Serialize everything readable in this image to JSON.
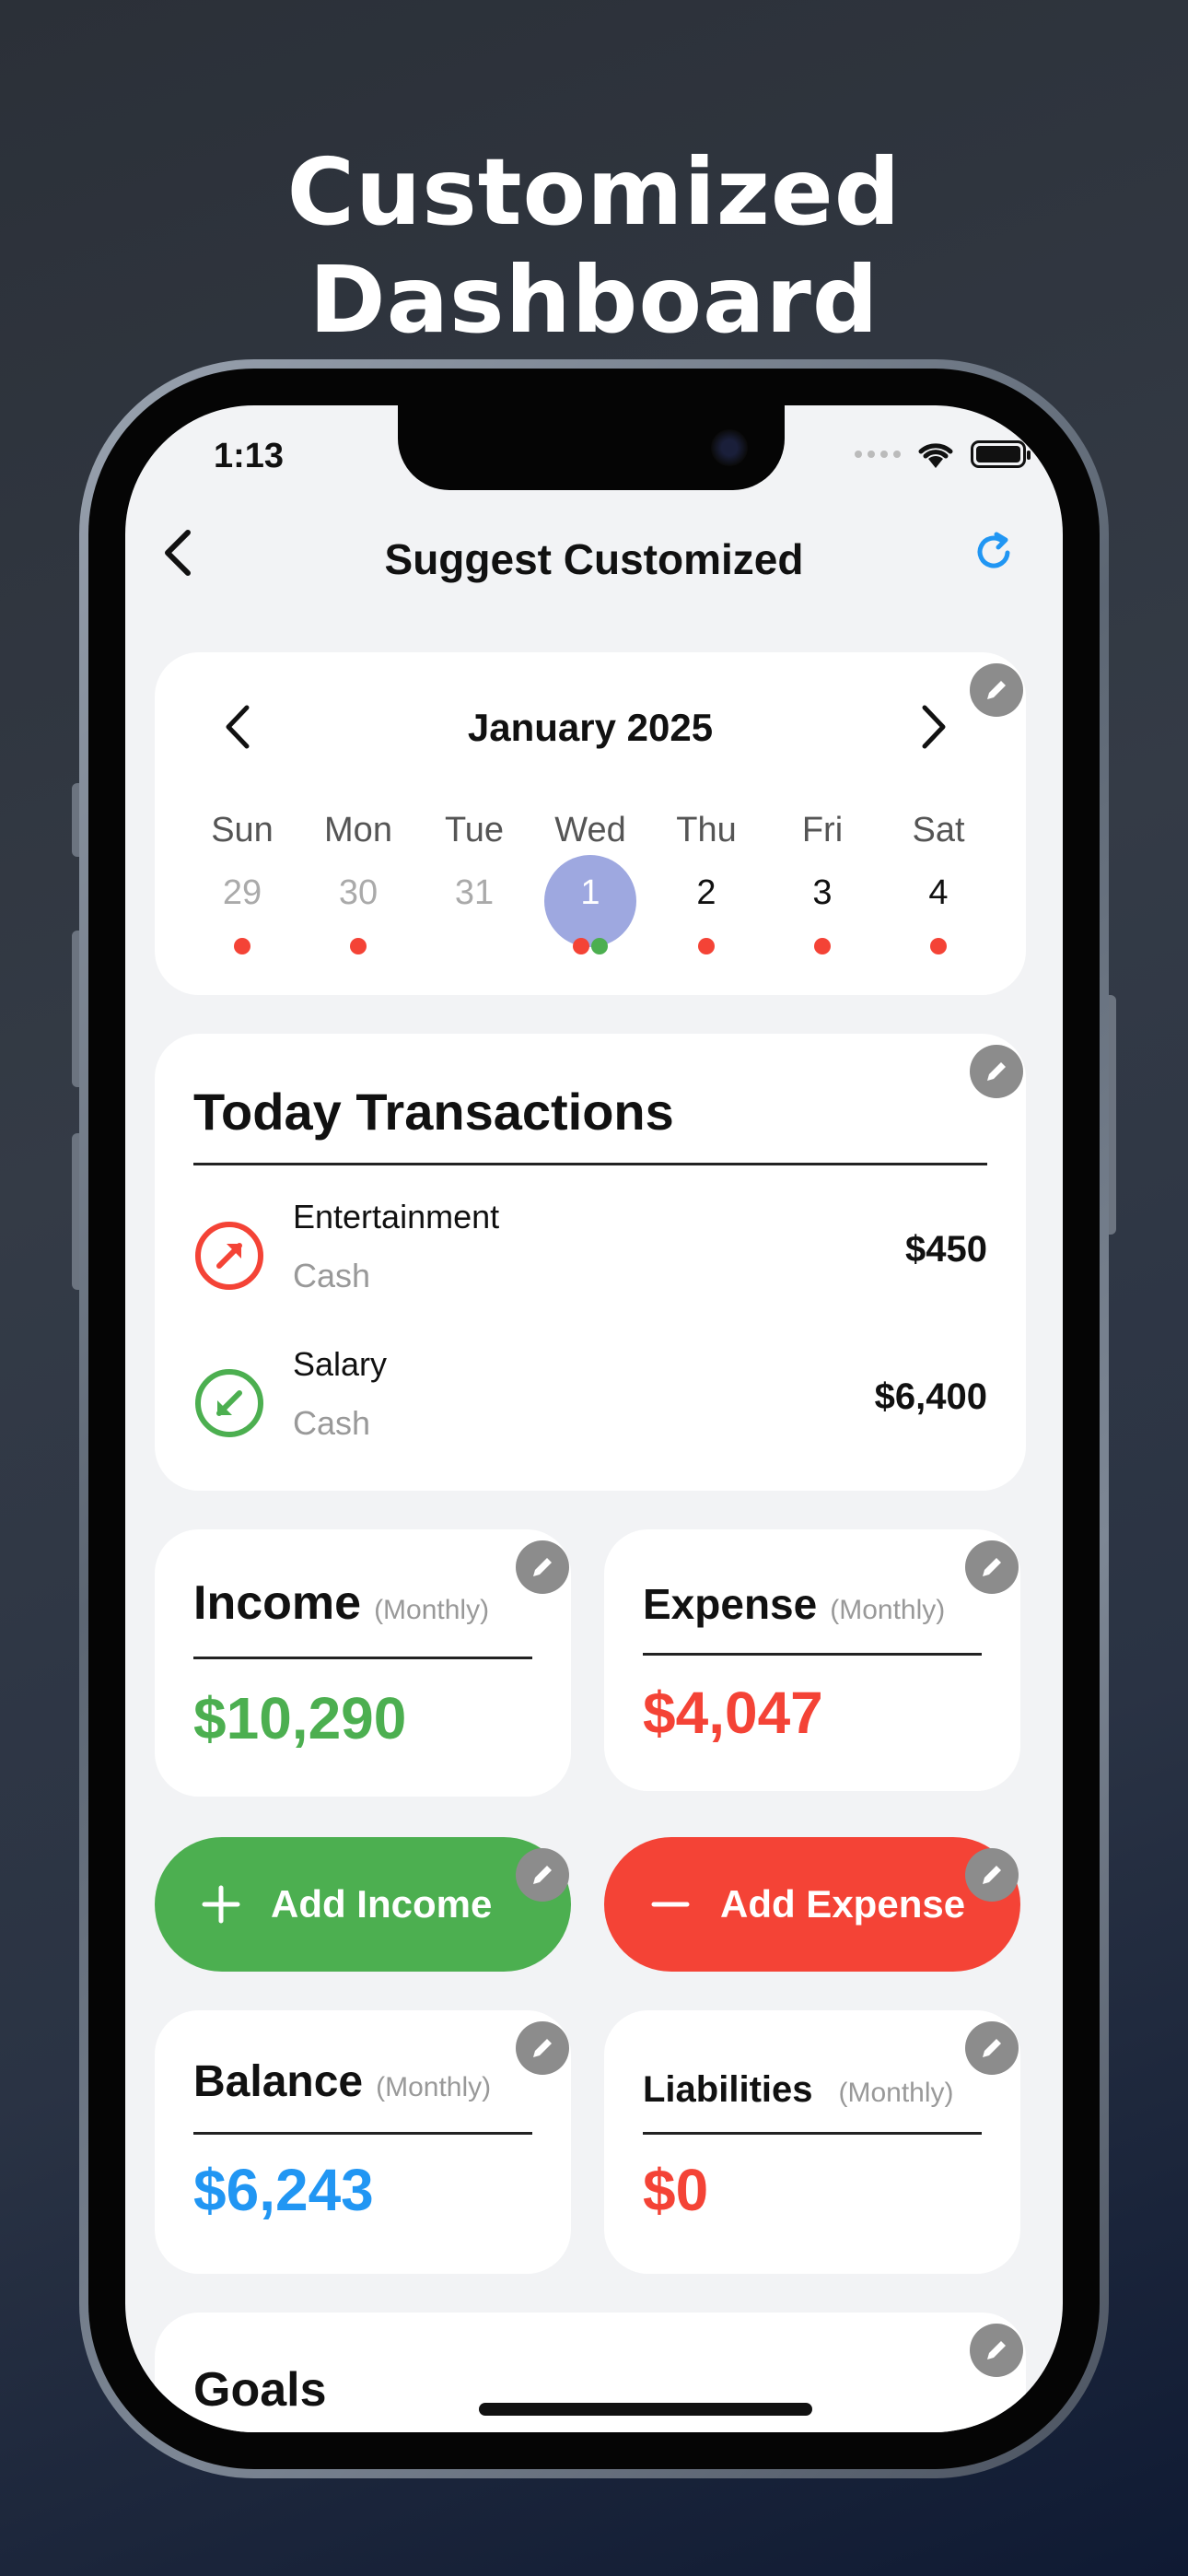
{
  "headline": "Customized Dashboard",
  "status": {
    "time": "1:13"
  },
  "nav": {
    "title": "Suggest Customized"
  },
  "calendar": {
    "month": "January 2025",
    "weekdays": [
      "Sun",
      "Mon",
      "Tue",
      "Wed",
      "Thu",
      "Fri",
      "Sat"
    ],
    "dates": [
      "29",
      "30",
      "31",
      "1",
      "2",
      "3",
      "4"
    ],
    "selected_date": "1"
  },
  "transactions": {
    "title": "Today Transactions",
    "items": [
      {
        "category": "Entertainment",
        "account": "Cash",
        "amount": "$450"
      },
      {
        "category": "Salary",
        "account": "Cash",
        "amount": "$6,400"
      }
    ]
  },
  "income": {
    "title": "Income",
    "period": "(Monthly)",
    "value": "$10,290"
  },
  "expense": {
    "title": "Expense",
    "period": "(Monthly)",
    "value": "$4,047"
  },
  "actions": {
    "add_income": "Add Income",
    "add_expense": "Add Expense"
  },
  "balance": {
    "title": "Balance",
    "period": "(Monthly)",
    "value": "$6,243"
  },
  "liabilities": {
    "title": "Liabilities",
    "period": "(Monthly)",
    "value": "$0"
  },
  "goals": {
    "title": "Goals"
  },
  "colors": {
    "income_green": "#4caf50",
    "expense_red": "#f44336",
    "balance_blue": "#2196f3",
    "selected_day": "#9ea8e0",
    "edit_gray": "#8c8c8c"
  },
  "icons": [
    "back-chevron-icon",
    "refresh-icon",
    "edit-pencil-icon",
    "expense-arrow-icon",
    "income-arrow-icon",
    "plus-icon",
    "minus-icon"
  ]
}
